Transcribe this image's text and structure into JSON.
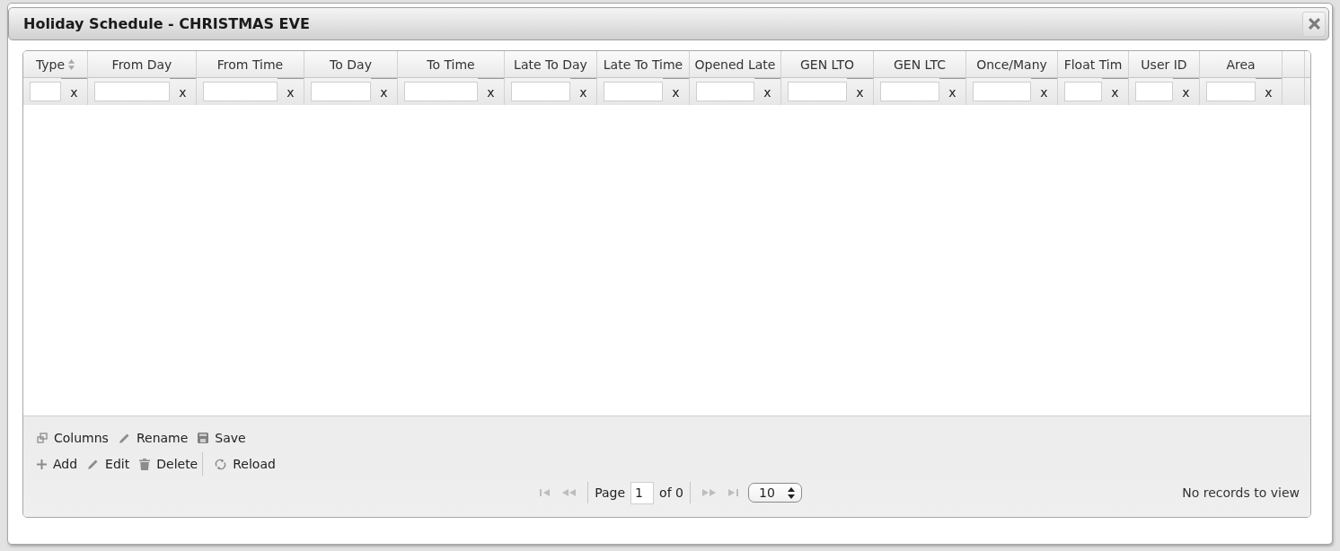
{
  "dialog": {
    "title": "Holiday Schedule - CHRISTMAS EVE"
  },
  "grid": {
    "columns": [
      {
        "label": "Type",
        "sort_icon": true,
        "clear": "x"
      },
      {
        "label": "From Day",
        "sort_icon": false,
        "clear": "x"
      },
      {
        "label": "From Time",
        "sort_icon": false,
        "clear": "x"
      },
      {
        "label": "To Day",
        "sort_icon": false,
        "clear": "x"
      },
      {
        "label": "To Time",
        "sort_icon": false,
        "clear": "x"
      },
      {
        "label": "Late To Day",
        "sort_icon": false,
        "clear": "x"
      },
      {
        "label": "Late To Time",
        "sort_icon": false,
        "clear": "x"
      },
      {
        "label": "Opened Late",
        "sort_icon": false,
        "clear": "x"
      },
      {
        "label": "GEN LTO",
        "sort_icon": false,
        "clear": "x"
      },
      {
        "label": "GEN LTC",
        "sort_icon": false,
        "clear": "x"
      },
      {
        "label": "Once/Many",
        "sort_icon": false,
        "clear": "x"
      },
      {
        "label": "Float Tim",
        "sort_icon": false,
        "clear": "x"
      },
      {
        "label": "User ID",
        "sort_icon": false,
        "clear": "x"
      },
      {
        "label": "Area",
        "sort_icon": false,
        "clear": "x"
      }
    ]
  },
  "footer": {
    "toolbar_rows": [
      {
        "items": [
          {
            "kind": "columns",
            "label": "Columns"
          },
          {
            "kind": "rename",
            "label": "Rename"
          },
          {
            "kind": "save",
            "label": "Save"
          }
        ]
      },
      {
        "items": [
          {
            "kind": "add",
            "label": "Add"
          },
          {
            "kind": "edit",
            "label": "Edit"
          },
          {
            "kind": "delete",
            "label": "Delete"
          },
          {
            "kind": "separator"
          },
          {
            "kind": "reload",
            "label": "Reload"
          }
        ]
      }
    ],
    "pager": {
      "buttons_before": [
        {
          "kind": "first",
          "disabled": true
        },
        {
          "kind": "prev",
          "disabled": true
        }
      ],
      "page_label": "Page",
      "page": "1",
      "of_label": "of 0",
      "buttons_after": [
        {
          "kind": "next",
          "disabled": true
        },
        {
          "kind": "last",
          "disabled": true
        }
      ],
      "rows_choice": "10"
    },
    "status": "No records to view"
  }
}
